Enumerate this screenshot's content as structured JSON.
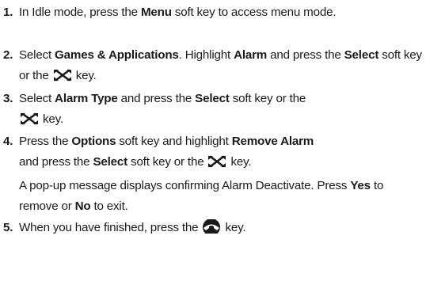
{
  "steps": [
    {
      "number": "1.",
      "t1": "In Idle mode, press the",
      "b1": "Menu",
      "t2": "soft key to access menu mode."
    },
    {
      "number": "2.",
      "t1": "Select",
      "b1": "Games & Applications",
      "t2": ". Highlight",
      "b2": "Alarm",
      "t3": "and press the",
      "b3": "Select",
      "t4": "soft key or the",
      "t5": "key."
    },
    {
      "number": "3.",
      "t1": "Select",
      "b1": "Alarm Type",
      "t2": "and press the",
      "b2": "Select",
      "t3": "soft key or the",
      "t4": "key."
    },
    {
      "number": "4.",
      "t1": "Press the",
      "b1": "Options",
      "t2": "soft key and highlight",
      "b2": "Remove Alarm",
      "t3": "and press the",
      "b3": "Select",
      "t4": "soft key or the",
      "t5": "key."
    },
    {
      "number": "5.",
      "t1": "When you have finished, press the",
      "t2": "key."
    }
  ],
  "note": {
    "t1": "A pop-up message displays confirming Alarm Deactivate. Press",
    "b1": "Yes",
    "t2": "to remove or",
    "b2": "No",
    "t3": "to exit."
  },
  "icons": {
    "nav_key": "nav-key-icon",
    "end_key": "end-key-icon"
  }
}
